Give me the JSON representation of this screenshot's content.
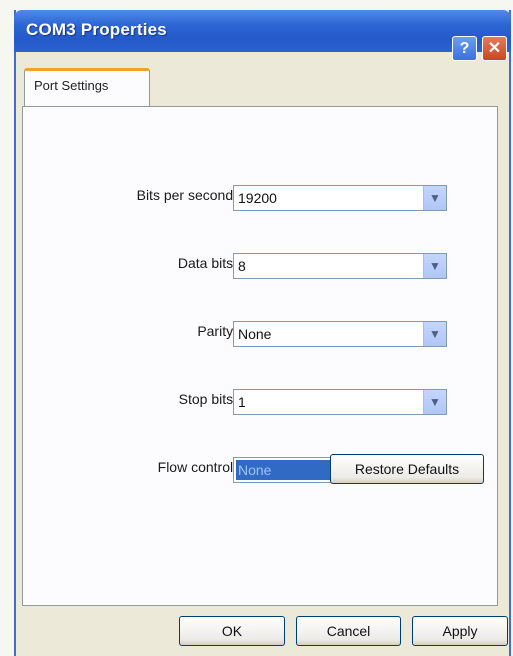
{
  "window": {
    "title": "COM3 Properties",
    "help_icon": "help-icon",
    "close_icon": "close-icon"
  },
  "tabs": [
    {
      "label": "Port Settings",
      "active": true
    }
  ],
  "fields": {
    "bits_per_second": {
      "label": "Bits per second:",
      "value": "19200"
    },
    "data_bits": {
      "label": "Data bits:",
      "value": "8"
    },
    "parity": {
      "label": "Parity:",
      "value": "None"
    },
    "stop_bits": {
      "label": "Stop bits:",
      "value": "1"
    },
    "flow_control": {
      "label": "Flow control:",
      "value": "None"
    }
  },
  "buttons": {
    "restore_defaults": "Restore Defaults",
    "ok": "OK",
    "cancel": "Cancel",
    "apply": "Apply"
  },
  "colors": {
    "title_bar": "#2459c9",
    "tab_highlight": "#f3a32b",
    "selection": "#316ac5"
  }
}
